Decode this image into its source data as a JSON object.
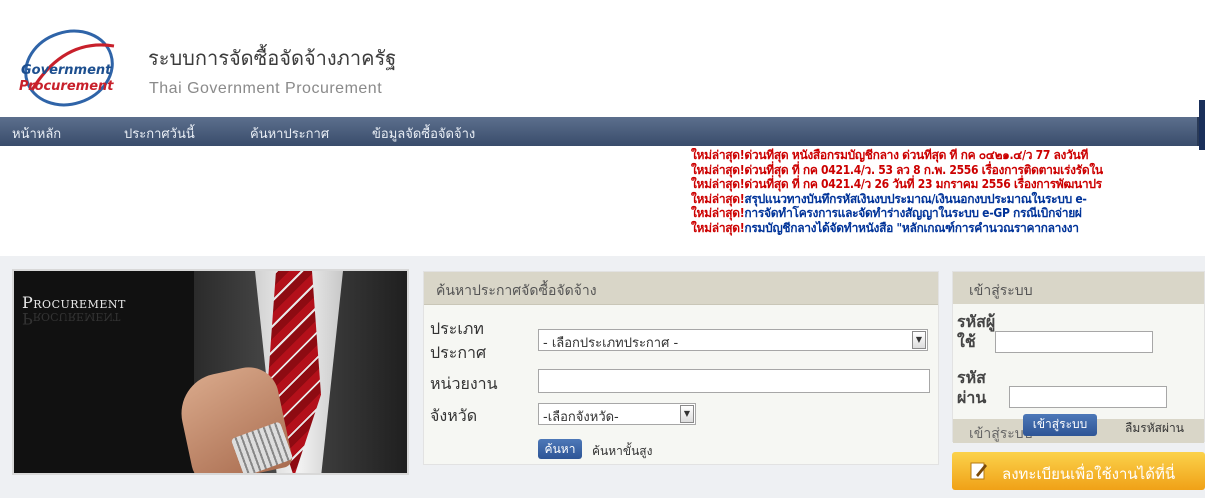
{
  "header": {
    "logo_line1": "Government",
    "logo_line2": "Procurement",
    "title_th": "ระบบการจัดซื้อจัดจ้างภาครัฐ",
    "title_en": "Thai Government Procurement"
  },
  "nav": {
    "items": [
      {
        "label": "หน้าหลัก"
      },
      {
        "label": "ประกาศวันนี้"
      },
      {
        "label": "ค้นหาประกาศ"
      },
      {
        "label": "ข้อมูลจัดซื้อจัดจ้าง"
      }
    ]
  },
  "news": {
    "items": [
      {
        "prefix": "ใหม่ล่าสุด!",
        "text": "ด่วนที่สุด หนังสือกรมบัญชีกลาง ด่วนที่สุด ที่ กค ๐๔๒๑.๔/ว 77 ลงวันที่",
        "color": "#cc0000"
      },
      {
        "prefix": "ใหม่ล่าสุด!",
        "text": "ด่วนที่สุด ที่ กค 0421.4/ว. 53 ลว 8 ก.พ. 2556 เรื่องการติดตามเร่งรัดใน",
        "color": "#cc0000"
      },
      {
        "prefix": "ใหม่ล่าสุด!",
        "text": "ด่วนที่สุด ที่ กค 0421.4/ว 26 วันที่ 23 มกราคม 2556 เรื่องการพัฒนาปร",
        "color": "#cc0000"
      },
      {
        "prefix": "ใหม่ล่าสุด!",
        "text": "สรุปแนวทางบันทึกรหัสเงินงบประมาณ/เงินนอกงบประมาณในระบบ e-",
        "color": "#003399"
      },
      {
        "prefix": "ใหม่ล่าสุด!",
        "text": "การจัดทำโครงการและจัดทำร่างสัญญาในระบบ e-GP กรณีเบิกจ่ายผ่",
        "color": "#003399"
      },
      {
        "prefix": "ใหม่ล่าสุด!",
        "text": "กรมบัญชีกลางได้จัดทำหนังสือ \"หลักเกณฑ์การคำนวณราคากลางงา",
        "color": "#003399"
      }
    ]
  },
  "promo": {
    "title": "Procurement"
  },
  "search": {
    "heading": "ค้นหาประกาศจัดซื้อจัดจ้าง",
    "type_label_1": "ประเภท",
    "type_label_2": "ประกาศ",
    "type_selected": "- เลือกประเภทประกาศ -",
    "agency_label": "หน่วยงาน",
    "agency_value": "",
    "province_label": "จังหวัด",
    "province_selected": "-เลือกจังหวัด-",
    "search_button": "ค้นหา",
    "advanced_link": "ค้นหาขั้นสูง"
  },
  "login": {
    "heading": "เข้าสู่ระบบ",
    "user_label_1": "รหัสผู้",
    "user_label_2": "ใช้",
    "pass_label_1": "รหัส",
    "pass_label_2": "ผ่าน",
    "login_button": "เข้าสู่ระบบ",
    "forgot_link": "ลืมรหัสผ่าน",
    "footer_heading": "เข้าสู่ระบบ"
  },
  "register": {
    "label": "ลงทะเบียนเพื่อใช้งานได้ที่นี่"
  }
}
